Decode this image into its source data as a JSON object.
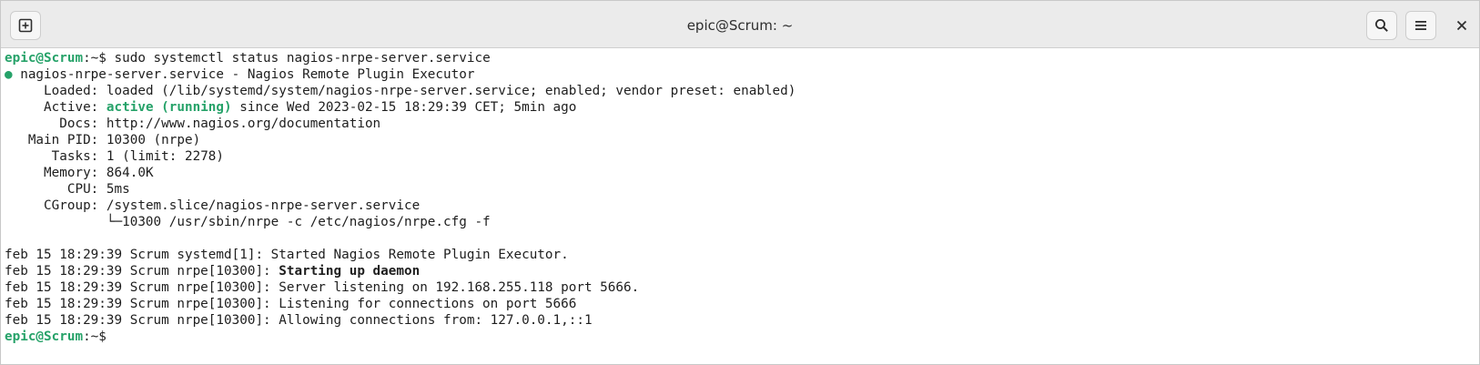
{
  "window": {
    "title": "epic@Scrum: ~"
  },
  "icons": {
    "new_tab": "new-tab-icon",
    "search": "search-icon",
    "menu": "hamburger-menu-icon",
    "close": "close-icon"
  },
  "colors": {
    "prompt_green": "#26a269",
    "titlebar_bg": "#ebebeb",
    "text": "#1e1e1e"
  },
  "terminal": {
    "prompt1": {
      "user_host": "epic@Scrum",
      "path": ":~$ ",
      "command": "sudo systemctl status nagios-nrpe-server.service"
    },
    "status": {
      "bullet": "●",
      "header": " nagios-nrpe-server.service - Nagios Remote Plugin Executor",
      "loaded_label": "     Loaded: ",
      "loaded_value": "loaded (/lib/systemd/system/nagios-nrpe-server.service; enabled; vendor preset: enabled)",
      "active_label": "     Active: ",
      "active_state": "active (running)",
      "active_rest": " since Wed 2023-02-15 18:29:39 CET; 5min ago",
      "docs_label": "       Docs: ",
      "docs_value": "http://www.nagios.org/documentation",
      "mainpid_label": "   Main PID: ",
      "mainpid_value": "10300 (nrpe)",
      "tasks_label": "      Tasks: ",
      "tasks_value": "1 (limit: 2278)",
      "memory_label": "     Memory: ",
      "memory_value": "864.0K",
      "cpu_label": "        CPU: ",
      "cpu_value": "5ms",
      "cgroup_label": "     CGroup: ",
      "cgroup_value": "/system.slice/nagios-nrpe-server.service",
      "cgroup_child": "             └─10300 /usr/sbin/nrpe -c /etc/nagios/nrpe.cfg -f"
    },
    "logs": [
      {
        "prefix": "feb 15 18:29:39 Scrum systemd[1]: ",
        "message": "Started Nagios Remote Plugin Executor."
      },
      {
        "prefix": "feb 15 18:29:39 Scrum nrpe[10300]: ",
        "message": "Starting up daemon"
      },
      {
        "prefix": "feb 15 18:29:39 Scrum nrpe[10300]: ",
        "message": "Server listening on 192.168.255.118 port 5666."
      },
      {
        "prefix": "feb 15 18:29:39 Scrum nrpe[10300]: ",
        "message": "Listening for connections on port 5666"
      },
      {
        "prefix": "feb 15 18:29:39 Scrum nrpe[10300]: ",
        "message": "Allowing connections from: 127.0.0.1,::1"
      }
    ],
    "prompt2": {
      "user_host": "epic@Scrum",
      "path": ":~$ "
    }
  }
}
